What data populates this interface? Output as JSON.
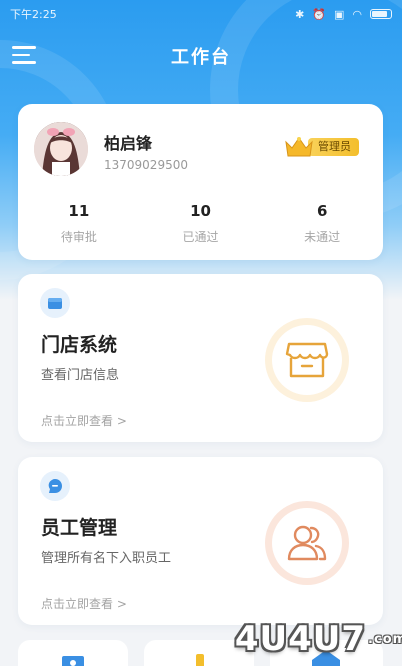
{
  "status_bar": {
    "time": "下午2:25",
    "icons": [
      "bluetooth-icon",
      "alarm-icon",
      "sim-icon",
      "wifi-icon",
      "battery-icon"
    ]
  },
  "header": {
    "title": "工作台",
    "menu_icon": "menu-icon"
  },
  "profile": {
    "name": "柏启锋",
    "phone": "13709029500",
    "role": "管理员",
    "stats": [
      {
        "value": "11",
        "label": "待审批"
      },
      {
        "value": "10",
        "label": "已通过"
      },
      {
        "value": "6",
        "label": "未通过"
      }
    ]
  },
  "entries": [
    {
      "title": "门店系统",
      "description": "查看门店信息",
      "link": "点击立即查看 >",
      "icon": "store-icon"
    },
    {
      "title": "员工管理",
      "description": "管理所有名下入职员工",
      "link": "点击立即查看 >",
      "icon": "staff-icon"
    }
  ],
  "watermark": {
    "text": "4U4U7",
    "suffix": ".com"
  },
  "colors": {
    "primary_blue": "#2b9cf0",
    "badge_gold": "#f3be2c",
    "store_orange": "#e6a43a",
    "staff_coral": "#e08a5f"
  }
}
